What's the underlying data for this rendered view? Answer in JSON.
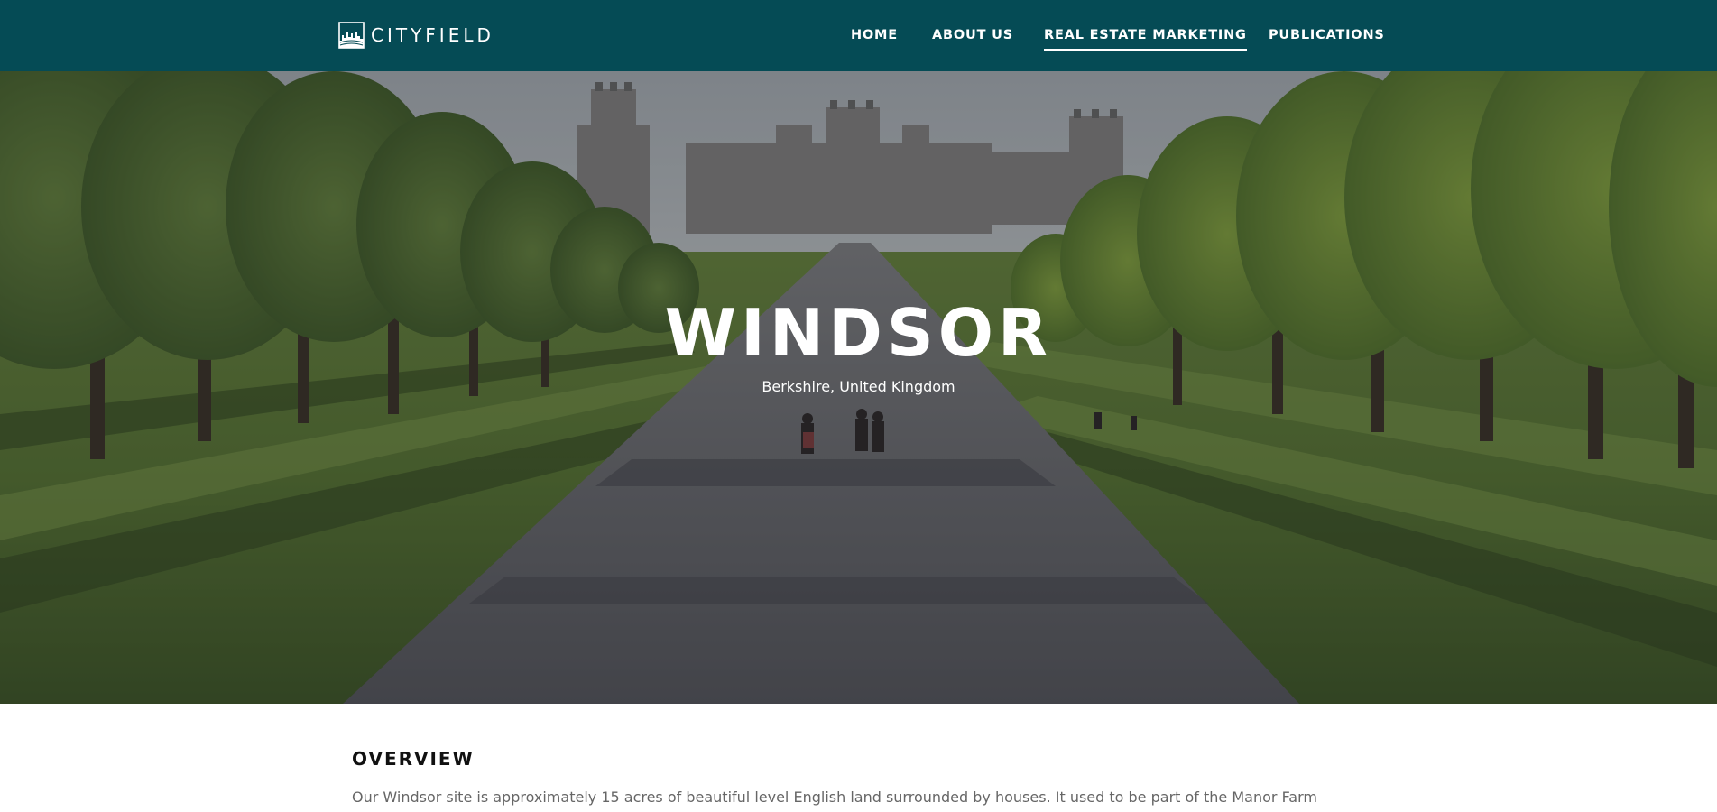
{
  "brand": {
    "name": "CITYFIELD",
    "header_bg": "#054b55",
    "text_color": "#ffffff"
  },
  "nav": {
    "items": [
      {
        "label": "HOME",
        "active": false
      },
      {
        "label": "ABOUT US",
        "active": false
      },
      {
        "label": "REAL ESTATE MARKETING",
        "active": true
      },
      {
        "label": "PUBLICATIONS",
        "active": false
      }
    ]
  },
  "hero": {
    "title": "WINDSOR",
    "subtitle": "Berkshire, United Kingdom"
  },
  "overview": {
    "heading": "OVERVIEW",
    "text": "Our Windsor site is approximately 15 acres of beautiful level English land surrounded by houses. It used to be part of the Manor Farm"
  },
  "colors": {
    "accent": "#054b55",
    "body_text": "#666666",
    "heading_text": "#111111"
  },
  "icons": {
    "logo": "castle-skyline-logo-icon"
  }
}
